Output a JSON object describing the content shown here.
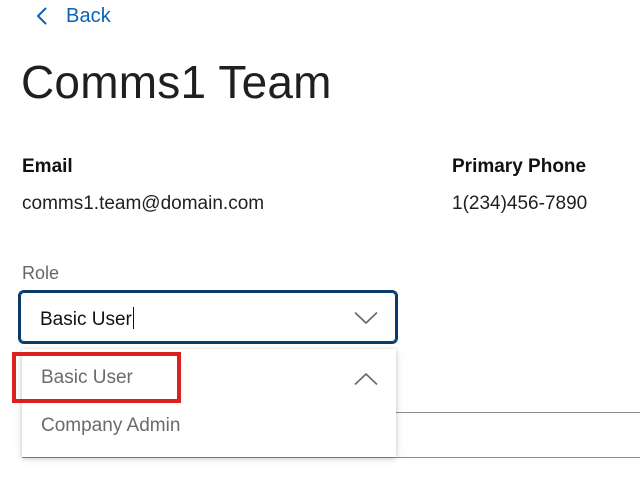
{
  "navigation": {
    "back_label": "Back",
    "back_icon": "chevron-left-icon"
  },
  "page": {
    "title": "Comms1 Team"
  },
  "contact": {
    "email_label": "Email",
    "email_value": "comms1.team@domain.com",
    "phone_label": "Primary Phone",
    "phone_value": "1(234)456-7890"
  },
  "role": {
    "label": "Role",
    "selected_value": "Basic User",
    "options": [
      {
        "label": "Basic User",
        "selected": true
      },
      {
        "label": "Company Admin",
        "selected": false
      }
    ]
  },
  "icons": {
    "select_chevron": "chevron-down-icon",
    "selected_option": "checkmark-icon"
  },
  "colors": {
    "link": "#0b63b6",
    "select_border": "#083a6c",
    "highlight": "#dc1f1f",
    "muted_text": "#6b6b6b"
  }
}
